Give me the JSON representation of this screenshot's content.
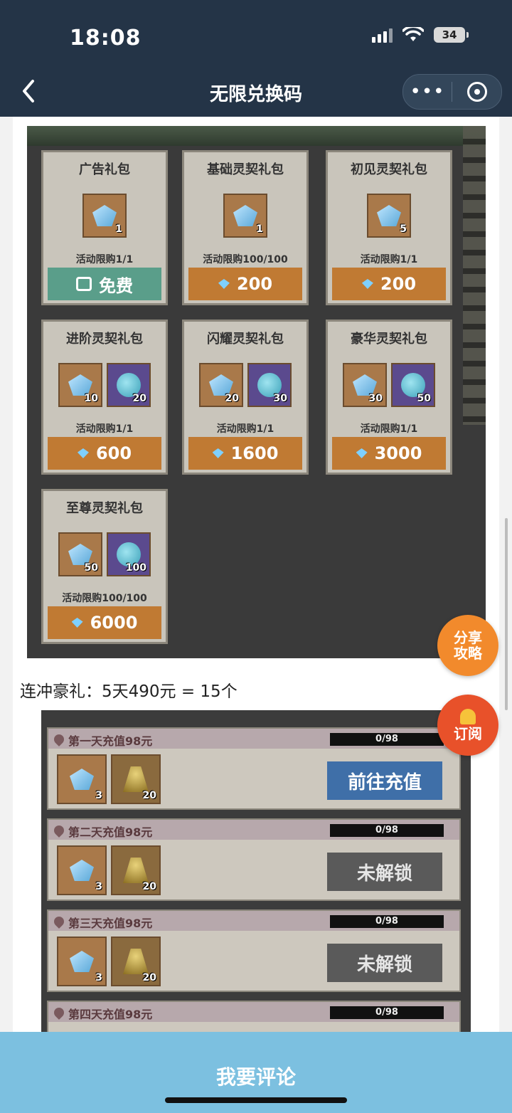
{
  "status": {
    "time": "18:08",
    "battery": "34"
  },
  "nav": {
    "title": "无限兑换码",
    "more": "•••"
  },
  "shop": {
    "packages": [
      {
        "name": "广告礼包",
        "limit": "活动限购1/1",
        "price": "免费",
        "items": [
          "1"
        ]
      },
      {
        "name": "基础灵契礼包",
        "limit": "活动限购100/100",
        "price": "200",
        "items": [
          "1"
        ]
      },
      {
        "name": "初见灵契礼包",
        "limit": "活动限购1/1",
        "price": "200",
        "items": [
          "5"
        ]
      },
      {
        "name": "进阶灵契礼包",
        "limit": "活动限购1/1",
        "price": "600",
        "items": [
          "10",
          "20"
        ]
      },
      {
        "name": "闪耀灵契礼包",
        "limit": "活动限购1/1",
        "price": "1600",
        "items": [
          "20",
          "30"
        ]
      },
      {
        "name": "豪华灵契礼包",
        "limit": "活动限购1/1",
        "price": "3000",
        "items": [
          "30",
          "50"
        ]
      },
      {
        "name": "至尊灵契礼包",
        "limit": "活动限购100/100",
        "price": "6000",
        "items": [
          "50",
          "100"
        ]
      }
    ]
  },
  "text": {
    "paragraph": "连冲豪礼：5天490元 = 15个"
  },
  "recharge": {
    "rows": [
      {
        "title": "第一天充值98元",
        "progress": "0/98",
        "button": "前往充值",
        "items": [
          "3",
          "20"
        ]
      },
      {
        "title": "第二天充值98元",
        "progress": "0/98",
        "button": "未解锁",
        "items": [
          "3",
          "20"
        ]
      },
      {
        "title": "第三天充值98元",
        "progress": "0/98",
        "button": "未解锁",
        "items": [
          "3",
          "20"
        ]
      },
      {
        "title": "第四天充值98元",
        "progress": "0/98",
        "button": "",
        "items": []
      }
    ]
  },
  "floating": {
    "share_l1": "分享",
    "share_l2": "攻略",
    "subscribe": "订阅"
  },
  "bottom": {
    "comment": "我要评论"
  },
  "colors": {
    "header": "#243447",
    "bottom_bar": "#7cc0e0",
    "share_fab": "#f28a2c",
    "sub_fab": "#e8512a"
  }
}
